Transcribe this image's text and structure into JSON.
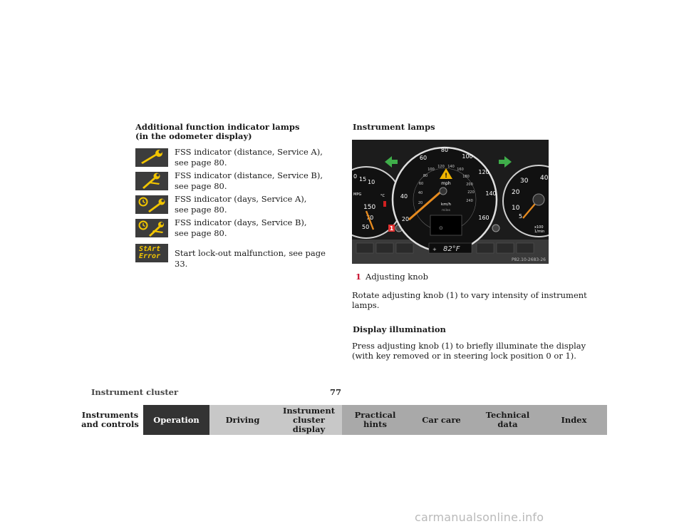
{
  "left": {
    "heading_line1": "Additional function indicator lamps",
    "heading_line2": "(in the odometer display)",
    "indicators": [
      {
        "icon": "wrench-icon",
        "line1": "FSS indicator (distance, Service  A),",
        "line2": "see page 80."
      },
      {
        "icon": "wrench-b-icon",
        "line1": "FSS indicator (distance, Service  B),",
        "line2": "see page 80."
      },
      {
        "icon": "clock-wrench-icon",
        "line1": "FSS indicator (days, Service A),",
        "line2": "see page 80."
      },
      {
        "icon": "clock-wrench-b-icon",
        "line1": "FSS indicator (days, Service B),",
        "line2": "see page 80."
      },
      {
        "icon": "start-error-icon",
        "line1": "Start lock-out malfunction, see page 33.",
        "line2": ""
      }
    ],
    "start_error_display": [
      "StArt",
      "Error"
    ]
  },
  "right": {
    "heading": "Instrument lamps",
    "figure": {
      "left_gauge_ticks": [
        "0",
        "15",
        "10",
        "150",
        "70",
        "50"
      ],
      "left_gauge_labels": [
        "MPG",
        "°C"
      ],
      "speedo_outer_ticks": [
        "20",
        "40",
        "60",
        "80",
        "100",
        "120",
        "140",
        "160"
      ],
      "speedo_inner_ticks": [
        "20",
        "40",
        "60",
        "80",
        "100",
        "120",
        "140",
        "160",
        "180",
        "200",
        "220",
        "240"
      ],
      "speedo_unit_mph": "mph",
      "speedo_unit_kmh": "km/h",
      "speedo_miles": "miles",
      "tacho_ticks": [
        "30",
        "40",
        "20",
        "10",
        "5"
      ],
      "tacho_unit_x": "x100",
      "tacho_unit_rpm": "1/min",
      "temperature_readout": "82°F",
      "temperature_plus": "+",
      "callout": "1",
      "ref": "P82.10-2683-26"
    },
    "callout_number": "1",
    "callout_label": "Adjusting knob",
    "para1_line1": "Rotate adjusting knob (1) to vary intensity of instrument",
    "para1_line2": "lamps.",
    "heading2": "Display illumination",
    "para2_line1": "Press adjusting knob (1) to briefly illuminate the display",
    "para2_line2": "(with key removed or in steering lock position 0 or 1)."
  },
  "footer": {
    "section": "Instrument cluster",
    "page": "77"
  },
  "nav": [
    {
      "label": "Instruments\nand controls",
      "style": "plain"
    },
    {
      "label": "Operation",
      "style": "active"
    },
    {
      "label": "Driving",
      "style": "light"
    },
    {
      "label": "Instrument\ncluster display",
      "style": "light"
    },
    {
      "label": "Practical hints",
      "style": "dark"
    },
    {
      "label": "Car care",
      "style": "dark"
    },
    {
      "label": "Technical\ndata",
      "style": "dark"
    },
    {
      "label": "Index",
      "style": "dark"
    }
  ],
  "watermark": "carmanualsonline.info",
  "colors": {
    "indicator_yellow": "#f2c500",
    "arrow_green": "#3fae4a",
    "needle": "#e58a1f",
    "warning": "#f0b400"
  }
}
